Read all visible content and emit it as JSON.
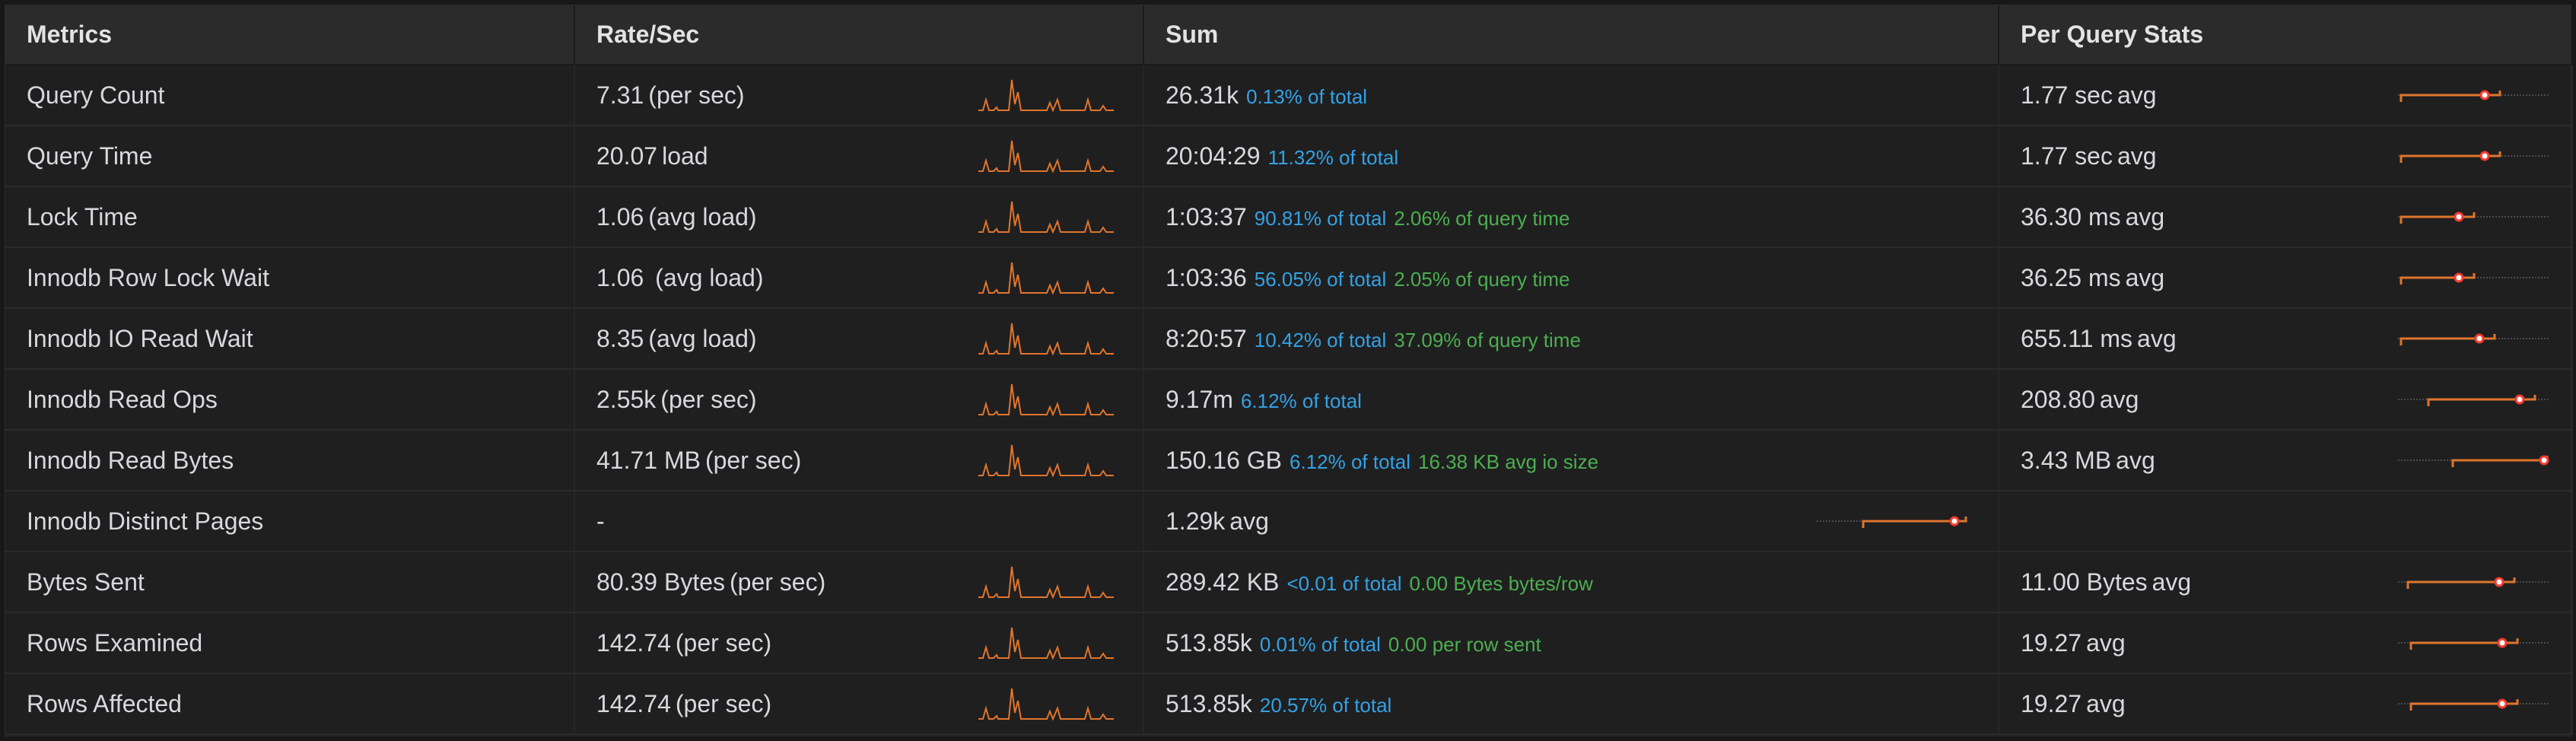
{
  "headers": {
    "metrics": "Metrics",
    "rate": "Rate/Sec",
    "sum": "Sum",
    "per_query": "Per Query Stats"
  },
  "colors": {
    "sparkline": "#e0752d",
    "percent_of_total": "#33a2e5",
    "secondary_stat": "#4caf50",
    "marker_dot": "#f53b2f"
  },
  "rows": [
    {
      "metric": "Query Count",
      "rate": {
        "value": "7.31",
        "unit": "(per sec)",
        "has_spark": true
      },
      "sum": {
        "value": "26.31k",
        "pct": "0.13% of total",
        "extra": ""
      },
      "per_query": {
        "value": "1.77 sec",
        "unit": "avg",
        "marker": 0.58
      }
    },
    {
      "metric": "Query Time",
      "rate": {
        "value": "20.07",
        "unit": "load",
        "has_spark": true
      },
      "sum": {
        "value": "20:04:29",
        "pct": "11.32% of total",
        "extra": ""
      },
      "per_query": {
        "value": "1.77 sec",
        "unit": "avg",
        "marker": 0.58
      }
    },
    {
      "metric": "Lock Time",
      "rate": {
        "value": "1.06",
        "unit": "(avg load)",
        "has_spark": true
      },
      "sum": {
        "value": "1:03:37",
        "pct": "90.81% of total",
        "extra": "2.06% of query time"
      },
      "per_query": {
        "value": "36.30 ms",
        "unit": "avg",
        "marker": 0.4
      }
    },
    {
      "metric": "Innodb Row Lock Wait",
      "rate": {
        "value": "1.06",
        "unit": " (avg load)",
        "has_spark": true
      },
      "sum": {
        "value": "1:03:36",
        "pct": "56.05% of total",
        "extra": "2.05% of query time"
      },
      "per_query": {
        "value": "36.25 ms",
        "unit": "avg",
        "marker": 0.4
      }
    },
    {
      "metric": "Innodb IO Read Wait",
      "rate": {
        "value": "8.35",
        "unit": "(avg load)",
        "has_spark": true
      },
      "sum": {
        "value": "8:20:57",
        "pct": "10.42% of total",
        "extra": "37.09% of query time"
      },
      "per_query": {
        "value": "655.11 ms",
        "unit": "avg",
        "marker": 0.54
      }
    },
    {
      "metric": "Innodb Read Ops",
      "rate": {
        "value": "2.55k",
        "unit": "(per sec)",
        "has_spark": true
      },
      "sum": {
        "value": "9.17m",
        "pct": "6.12% of total",
        "extra": ""
      },
      "per_query": {
        "value": "208.80",
        "unit": "avg",
        "marker": 0.82
      }
    },
    {
      "metric": "Innodb Read Bytes",
      "rate": {
        "value": "41.71 MB",
        "unit": "(per sec)",
        "has_spark": true
      },
      "sum": {
        "value": "150.16 GB",
        "pct": "6.12% of total",
        "extra": "16.38 KB avg io size"
      },
      "per_query": {
        "value": "3.43 MB",
        "unit": "avg",
        "marker": 0.99
      }
    },
    {
      "metric": "Innodb Distinct Pages",
      "rate": {
        "value": "-",
        "unit": "",
        "has_spark": false
      },
      "sum": {
        "value": "1.29k",
        "unit": "avg",
        "pct": "",
        "extra": "",
        "marker": 0.93
      },
      "per_query": {
        "value": "",
        "unit": "",
        "marker": null
      }
    },
    {
      "metric": "Bytes Sent",
      "rate": {
        "value": "80.39 Bytes",
        "unit": "(per sec)",
        "has_spark": true
      },
      "sum": {
        "value": "289.42 KB",
        "pct": "<0.01 of total",
        "extra": "0.00 Bytes bytes/row"
      },
      "per_query": {
        "value": "11.00 Bytes",
        "unit": "avg",
        "marker": 0.68
      }
    },
    {
      "metric": "Rows Examined",
      "rate": {
        "value": "142.74",
        "unit": "(per sec)",
        "has_spark": true
      },
      "sum": {
        "value": "513.85k",
        "pct": "0.01% of total",
        "extra": "0.00 per row sent"
      },
      "per_query": {
        "value": "19.27",
        "unit": "avg",
        "marker": 0.7
      }
    },
    {
      "metric": "Rows Affected",
      "rate": {
        "value": "142.74",
        "unit": "(per sec)",
        "has_spark": true
      },
      "sum": {
        "value": "513.85k",
        "pct": "20.57% of total",
        "extra": ""
      },
      "per_query": {
        "value": "19.27",
        "unit": "avg",
        "marker": 0.7
      }
    }
  ]
}
